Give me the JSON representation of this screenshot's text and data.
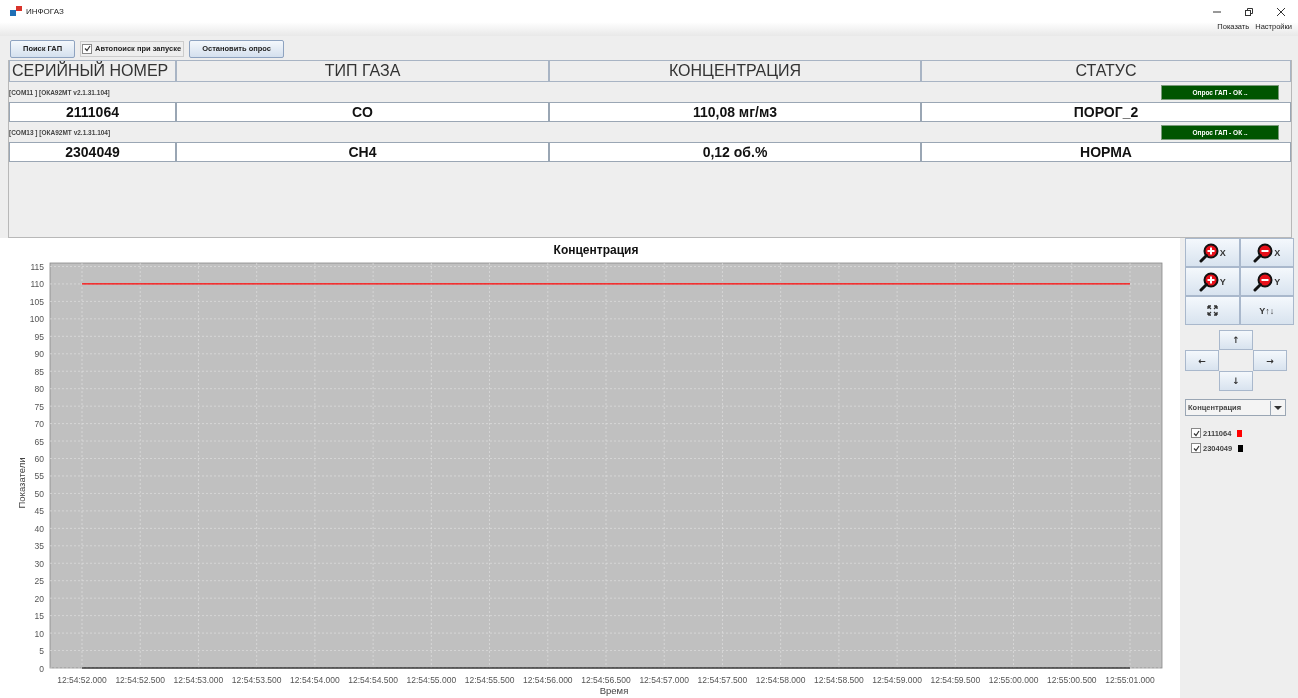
{
  "window": {
    "title": "ИНФОГАЗ"
  },
  "menu": [
    "Показать",
    "Настройки"
  ],
  "toolbar": {
    "search_button": "Поиск ГАП",
    "autosearch": {
      "label": "Автопоиск при запуске",
      "checked": true
    },
    "stop_button": "Остановить опрос"
  },
  "table": {
    "columns": [
      "СЕРИЙНЫЙ НОМЕР",
      "ТИП ГАЗА",
      "КОНЦЕНТРАЦИЯ",
      "СТАТУС"
    ],
    "rows": [
      {
        "port_info": "[COM11 ] [ОКА92МТ v2.1.31.104]",
        "poll_status": "Опрос  ГАП - ОК ..",
        "cells": [
          "2111064",
          "CO",
          "110,08 мг/м3",
          "ПОРОГ_2"
        ]
      },
      {
        "port_info": "[COM13 ] [ОКА92МТ v2.1.31.104]",
        "poll_status": "Опрос  ГАП - ОК ..",
        "cells": [
          "2304049",
          "CH4",
          "0,12 об.%",
          "НОРМА"
        ]
      }
    ]
  },
  "chart": {
    "chart_data": {
      "type": "line",
      "title": "Концентрация",
      "xlabel": "Время",
      "ylabel": "Показатели",
      "categories": [
        "12:54:52.000",
        "12:54:52.500",
        "12:54:53.000",
        "12:54:53.500",
        "12:54:54.000",
        "12:54:54.500",
        "12:54:55.000",
        "12:54:55.500",
        "12:54:56.000",
        "12:54:56.500",
        "12:54:57.000",
        "12:54:57.500",
        "12:54:58.000",
        "12:54:58.500",
        "12:54:59.000",
        "12:54:59.500",
        "12:55:00.000",
        "12:55:00.500",
        "12:55:01.000"
      ],
      "series": [
        {
          "name": "2111064",
          "color": "#ff0000",
          "values": [
            110,
            110,
            110,
            110,
            110,
            110,
            110,
            110,
            110,
            110,
            110,
            110,
            110,
            110,
            110,
            110,
            110,
            110,
            110
          ]
        },
        {
          "name": "2304049",
          "color": "#000000",
          "values": [
            0,
            0,
            0,
            0,
            0,
            0,
            0,
            0,
            0,
            0,
            0,
            0,
            0,
            0,
            0,
            0,
            0,
            0,
            0
          ]
        }
      ],
      "ylim": [
        0,
        116
      ],
      "grid": true,
      "yticks": [
        0,
        5,
        10,
        15,
        20,
        25,
        30,
        35,
        40,
        45,
        50,
        55,
        60,
        65,
        70,
        75,
        80,
        85,
        90,
        95,
        100,
        105,
        110,
        115
      ]
    }
  },
  "controls": {
    "zoom_buttons": [
      {
        "kind": "zoom-in",
        "axis": "X"
      },
      {
        "kind": "zoom-out",
        "axis": "X"
      },
      {
        "kind": "zoom-in",
        "axis": "Y"
      },
      {
        "kind": "zoom-out",
        "axis": "Y"
      }
    ],
    "autoscale_label": "Y↑↓",
    "pan": {
      "up": "↑",
      "left": "←",
      "right": "→",
      "down": "↓"
    },
    "dropdown": "Концентрация",
    "series_toggles": [
      {
        "checked": true
      },
      {
        "checked": true
      }
    ]
  }
}
